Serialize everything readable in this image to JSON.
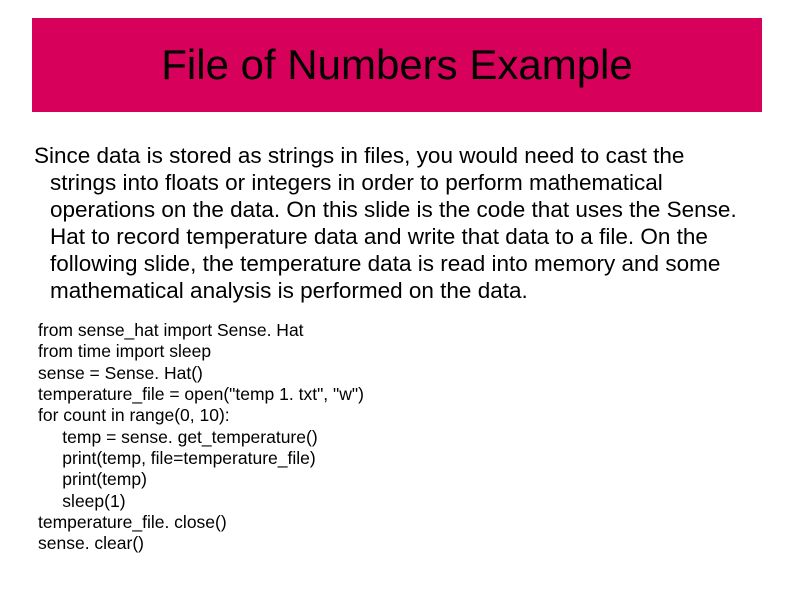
{
  "title": "File of Numbers Example",
  "paragraph": "Since data is stored as strings in files, you would need to cast the strings into floats or integers in order to perform mathematical operations on the data.  On this slide is the code that uses the Sense. Hat to record temperature data and write that data to a file. On the following slide, the temperature data is read into memory and some mathematical analysis is performed on the data.",
  "code": "from sense_hat import Sense. Hat\nfrom time import sleep\nsense = Sense. Hat()\ntemperature_file = open(\"temp 1. txt\", \"w\")\nfor count in range(0, 10):\n     temp = sense. get_temperature()\n     print(temp, file=temperature_file)\n     print(temp)\n     sleep(1)\ntemperature_file. close()\nsense. clear()"
}
